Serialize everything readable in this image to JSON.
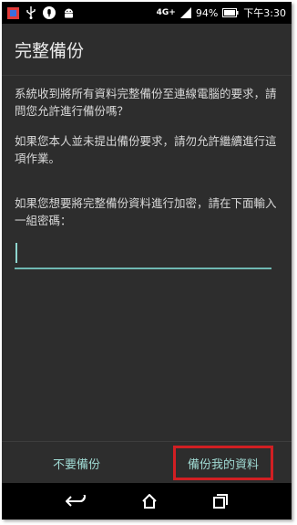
{
  "status_bar": {
    "icons_left": [
      "app-notification-icon",
      "usb-icon",
      "voice-mic-icon",
      "android-icon"
    ],
    "network": "4G+",
    "battery": "94%",
    "time": "下午3:30"
  },
  "dialog": {
    "title": "完整備份",
    "message_1": "系統收到將所有資料完整備份至連線電腦的要求，請問您允許進行備份嗎？",
    "message_2": "如果您本人並未提出備份要求，請勿允許繼續進行這項作業。",
    "prompt": "如果您想要將完整備份資料進行加密，請在下面輸入一組密碼：",
    "password_value": ""
  },
  "buttons": {
    "deny": "不要備份",
    "confirm": "備份我的資料"
  },
  "colors": {
    "background": "#2d2d2d",
    "accent": "#9fd9d2",
    "highlight_border": "#d11f23"
  }
}
